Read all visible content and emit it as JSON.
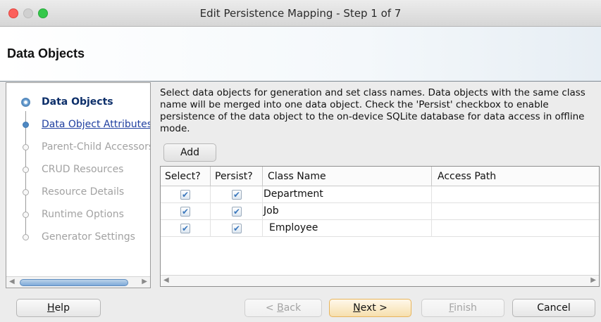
{
  "window": {
    "title": "Edit Persistence Mapping - Step 1 of 7"
  },
  "header": {
    "title": "Data Objects"
  },
  "nav": {
    "items": [
      {
        "label": "Data Objects"
      },
      {
        "label": "Data Object Attributes"
      },
      {
        "label": "Parent-Child Accessors"
      },
      {
        "label": "CRUD Resources"
      },
      {
        "label": "Resource Details"
      },
      {
        "label": "Runtime Options"
      },
      {
        "label": "Generator Settings"
      }
    ]
  },
  "main": {
    "description": "Select data objects for generation and set class names. Data objects with the same class name will be merged into one data object. Check the 'Persist' checkbox to enable persistence of the data object to the on-device SQLite database for data access in offline mode.",
    "add_label": "Add",
    "table": {
      "columns": [
        "Select?",
        "Persist?",
        "Class Name",
        "Access Path"
      ],
      "rows": [
        {
          "select": true,
          "persist": true,
          "class_name": "Department",
          "access_path": ""
        },
        {
          "select": true,
          "persist": true,
          "class_name": "Job",
          "access_path": ""
        },
        {
          "select": true,
          "persist": true,
          "class_name": "Employee",
          "access_path": ""
        }
      ]
    }
  },
  "footer": {
    "help": {
      "underlined": "H",
      "rest": "elp"
    },
    "back": {
      "prefix": "< ",
      "underlined": "B",
      "rest": "ack"
    },
    "next": {
      "underlined": "N",
      "rest": "ext >"
    },
    "finish": {
      "underlined": "F",
      "rest": "inish"
    },
    "cancel": {
      "label": "Cancel"
    }
  },
  "icons": {
    "check": "checkmark-icon",
    "scroll_left": "scroll-left-icon",
    "scroll_right": "scroll-right-icon"
  },
  "colors": {
    "accent": "#2f6aa4",
    "primary_button": "#f6dfad",
    "link": "#1f3fa0"
  }
}
